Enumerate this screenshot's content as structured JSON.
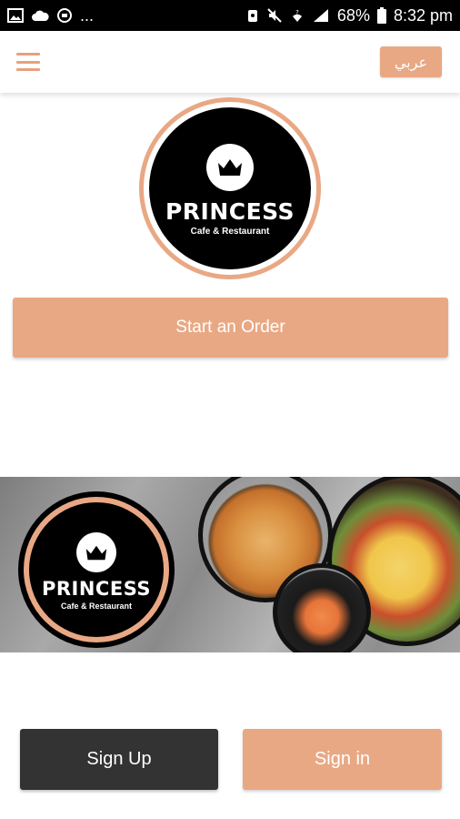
{
  "status_bar": {
    "left_icons": [
      "image-icon",
      "cloud-icon",
      "sync-icon"
    ],
    "overflow": "...",
    "right_icons": [
      "alarm-icon",
      "mute-icon",
      "wifi-icon",
      "signal-icon",
      "battery-icon"
    ],
    "battery_percent": "68%",
    "time": "8:32 pm"
  },
  "app_bar": {
    "menu_icon": "hamburger-menu-icon",
    "language_label": "عربي"
  },
  "logo": {
    "name": "PRINCESS",
    "subtitle": "Cafe & Restaurant",
    "icon": "crown-icon"
  },
  "start_order_label": "Start an Order",
  "banner": {
    "name": "PRINCESS",
    "subtitle": "Cafe & Restaurant"
  },
  "auth": {
    "sign_up_label": "Sign Up",
    "sign_in_label": "Sign in"
  },
  "colors": {
    "accent": "#e9a884",
    "dark_button": "#333333",
    "status_bar": "#000000"
  }
}
